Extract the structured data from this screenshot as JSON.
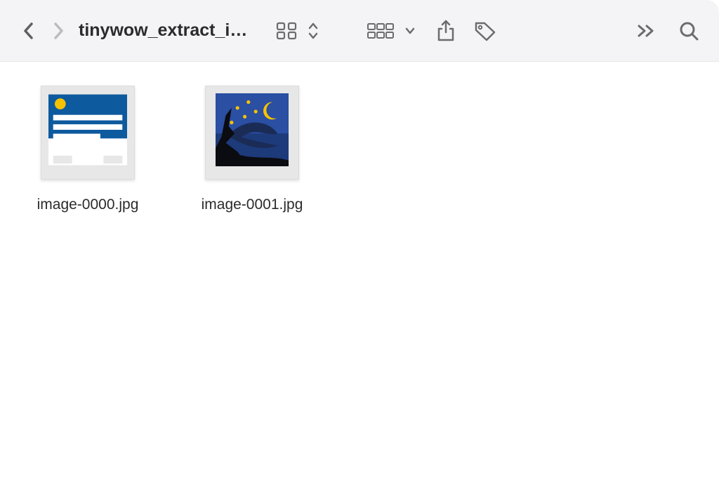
{
  "toolbar": {
    "folder_title": "tinywow_extract_i…"
  },
  "files": [
    {
      "name": "image-0000.jpg"
    },
    {
      "name": "image-0001.jpg"
    }
  ]
}
